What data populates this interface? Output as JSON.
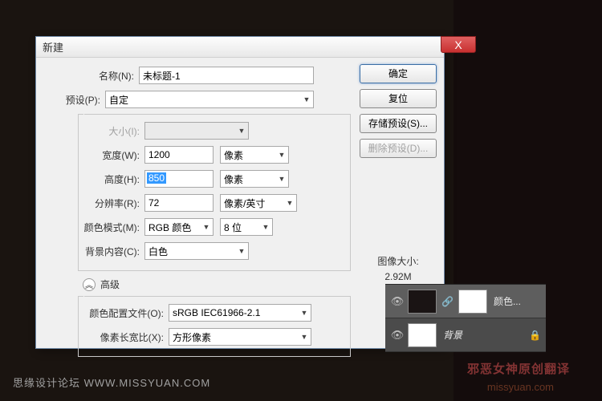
{
  "dialog": {
    "title": "新建",
    "close": "X",
    "labels": {
      "name": "名称(N):",
      "preset": "预设(P):",
      "size": "大小(I):",
      "width": "宽度(W):",
      "height": "高度(H):",
      "resolution": "分辨率(R):",
      "colormode": "颜色模式(M):",
      "bgcontent": "背景内容(C):",
      "advanced": "高级",
      "profile": "颜色配置文件(O):",
      "aspect": "像素长宽比(X):"
    },
    "values": {
      "name": "未标题-1",
      "preset": "自定",
      "size": "",
      "width": "1200",
      "height": "850",
      "resolution": "72",
      "colormode": "RGB 颜色",
      "bitdepth": "8 位",
      "bgcontent": "白色",
      "profile": "sRGB IEC61966-2.1",
      "aspect": "方形像素"
    },
    "units": {
      "width": "像素",
      "height": "像素",
      "resolution": "像素/英寸"
    },
    "buttons": {
      "ok": "确定",
      "reset": "复位",
      "savepreset": "存储预设(S)...",
      "delpreset": "删除预设(D)..."
    },
    "imagesize": {
      "label": "图像大小:",
      "value": "2.92M"
    }
  },
  "layers": {
    "row1_name": "颜色...",
    "row2_name": "背景"
  },
  "footer": {
    "site": "思缘设计论坛   WWW.MISSYUAN.COM",
    "credit": "邪恶女神原创翻译",
    "url": "missyuan.com"
  }
}
